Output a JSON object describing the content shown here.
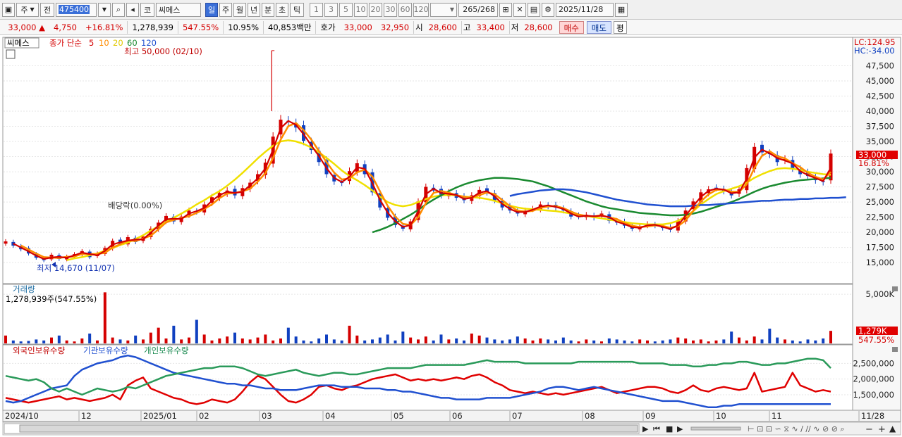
{
  "toolbar": {
    "period_label": "주",
    "prev_label": "전",
    "code": "475400",
    "market_label": "코",
    "name": "씨메스",
    "periods": [
      "일",
      "주",
      "월",
      "년",
      "분",
      "초",
      "틱"
    ],
    "active_period": "일",
    "intervals": [
      "1",
      "3",
      "5",
      "10",
      "20",
      "30",
      "60",
      "120"
    ],
    "count": "265",
    "count_total": "/268",
    "date": "2025/11/28"
  },
  "quote": {
    "price": "33,000",
    "change": "4,750",
    "change_pct": "+16.81%",
    "volume": "1,278,939",
    "volume_pct": "547.55%",
    "turnover": "10.95%",
    "amount": "40,853백만",
    "bid_label": "호가",
    "ask": "33,000",
    "bid": "32,950",
    "open_label": "시",
    "open": "28,600",
    "high_label": "고",
    "high": "33,400",
    "low_label": "저",
    "low": "28,600",
    "buy_label": "매수",
    "sell_label": "매도",
    "eval_label": "평"
  },
  "colors": {
    "up": "#d40000",
    "down": "#1040c0",
    "ma5": "#d40000",
    "ma10": "#ff8c00",
    "ma20": "#f0e000",
    "ma60": "#1a8a30",
    "ma120": "#2050d0"
  },
  "chart_data": [
    {
      "type": "candlestick",
      "title": "씨메스",
      "legend": [
        "종가 단순",
        "5",
        "10",
        "20",
        "60",
        "120"
      ],
      "x": [
        "2024/10",
        "12",
        "2025/01",
        "02",
        "03",
        "04",
        "05",
        "06",
        "07",
        "08",
        "09",
        "10",
        "11",
        "11/28"
      ],
      "y_ticks": [
        15000,
        17500,
        20000,
        22500,
        25000,
        27500,
        30000,
        32500,
        35000,
        37500,
        40000,
        42500,
        45000,
        47500
      ],
      "y_tick_labels": [
        "15,000",
        "17,500",
        "20,000",
        "22,500",
        "25,000",
        "27,500",
        "30,000",
        "32,500",
        "35,000",
        "37,500",
        "40,000",
        "42,500",
        "45,000",
        "47,500"
      ],
      "ylim": [
        12000,
        51500
      ],
      "annotations": {
        "max": "최고 50,000 (02/10)",
        "min": "최저 14,670 (11/07)",
        "dividend": "배당락(0.00%)",
        "lc": "LC:124.95",
        "hc": "HC:-34.00",
        "last_price": "33,000",
        "last_pct": "16.81%"
      },
      "series": [
        {
          "name": "close",
          "values": [
            18500,
            17800,
            17200,
            16500,
            15800,
            15400,
            16300,
            15600,
            16000,
            16400,
            16900,
            15900,
            16500,
            17400,
            18600,
            18100,
            19200,
            18400,
            19300,
            20600,
            21600,
            22700,
            21800,
            22600,
            23600,
            23400,
            24600,
            25800,
            26500,
            26900,
            26100,
            27300,
            28200,
            29600,
            31500,
            35800,
            38600,
            38200,
            37300,
            35100,
            33600,
            31600,
            29600,
            28400,
            28200,
            30100,
            31400,
            29600,
            26600,
            24100,
            22400,
            21200,
            20600,
            21800,
            25100,
            27500,
            26900,
            26100,
            26600,
            25700,
            25300,
            26100,
            27000,
            26600,
            25300,
            24100,
            23600,
            23100,
            23600,
            23900,
            24600,
            24300,
            24100,
            23600,
            22600,
            22600,
            22900,
            22400,
            23100,
            21900,
            21600,
            21100,
            20600,
            20900,
            21400,
            21100,
            20700,
            20400,
            21900,
            23600,
            25100,
            26600,
            27100,
            27300,
            26800,
            26100,
            27100,
            30600,
            34100,
            33200,
            32900,
            31600,
            32100,
            30600,
            29600,
            29300,
            28600,
            28300,
            33000
          ]
        },
        {
          "name": "ma20",
          "values": [
            null,
            null,
            null,
            null,
            null,
            null,
            null,
            null,
            15400,
            15700,
            15900,
            16200,
            16500,
            17000,
            17400,
            17900,
            18300,
            18900,
            19500,
            20300,
            21000,
            21700,
            22400,
            23100,
            23800,
            24600,
            25300,
            26100,
            26800,
            27700,
            28700,
            29800,
            31000,
            32200,
            33300,
            34300,
            35000,
            35200,
            35000,
            34600,
            34000,
            33200,
            32300,
            31300,
            30200,
            29300,
            28600,
            27800,
            26900,
            25900,
            25000,
            24500,
            24300,
            24500,
            25000,
            25500,
            25900,
            26100,
            26200,
            26100,
            25900,
            25800,
            25700,
            25500,
            25200,
            24800,
            24400,
            24100,
            23900,
            23800,
            23700,
            23600,
            23500,
            23300,
            23100,
            22900,
            22700,
            22500,
            22300,
            22100,
            21900,
            21700,
            21500,
            21400,
            21300,
            21300,
            21300,
            21500,
            21900,
            22600,
            23500,
            24600,
            25500,
            26300,
            26800,
            27200,
            27600,
            28200,
            29000,
            29600,
            30100,
            30500,
            30600,
            30500,
            30300,
            30000,
            29800,
            29600,
            29500
          ]
        },
        {
          "name": "ma60",
          "values": [
            null,
            null,
            null,
            null,
            null,
            null,
            null,
            null,
            null,
            null,
            null,
            null,
            null,
            null,
            null,
            null,
            null,
            null,
            null,
            null,
            null,
            null,
            null,
            null,
            null,
            null,
            null,
            null,
            null,
            null,
            null,
            null,
            null,
            null,
            null,
            null,
            null,
            null,
            null,
            null,
            null,
            null,
            null,
            null,
            null,
            null,
            null,
            null,
            20000,
            20400,
            20900,
            21500,
            22200,
            22900,
            23700,
            24600,
            25400,
            26100,
            26800,
            27400,
            27900,
            28300,
            28600,
            28800,
            29000,
            29000,
            28900,
            28800,
            28600,
            28400,
            28000,
            27600,
            27100,
            26600,
            26100,
            25600,
            25100,
            24700,
            24300,
            24000,
            23800,
            23600,
            23400,
            23200,
            23100,
            23000,
            22900,
            22800,
            22800,
            22900,
            23100,
            23400,
            23800,
            24200,
            24600,
            25000,
            25500,
            26100,
            26700,
            27200,
            27600,
            27900,
            28200,
            28400,
            28600,
            28700,
            28800,
            28900,
            29000
          ]
        },
        {
          "name": "ma120",
          "values": [
            null,
            null,
            null,
            null,
            null,
            null,
            null,
            null,
            null,
            null,
            null,
            null,
            null,
            null,
            null,
            null,
            null,
            null,
            null,
            null,
            null,
            null,
            null,
            null,
            null,
            null,
            null,
            null,
            null,
            null,
            null,
            null,
            null,
            null,
            null,
            null,
            null,
            null,
            null,
            null,
            null,
            null,
            null,
            null,
            null,
            null,
            null,
            null,
            null,
            null,
            null,
            null,
            null,
            null,
            null,
            null,
            null,
            null,
            null,
            null,
            null,
            null,
            null,
            null,
            null,
            null,
            26000,
            26300,
            26500,
            26700,
            26900,
            27000,
            27100,
            27100,
            27000,
            26800,
            26600,
            26300,
            26000,
            25700,
            25400,
            25200,
            25000,
            24800,
            24600,
            24500,
            24400,
            24300,
            24300,
            24300,
            24400,
            24500,
            24500,
            24600,
            24700,
            24800,
            24900,
            25000,
            25100,
            25200,
            25200,
            25300,
            25400,
            25400,
            25500,
            25500,
            25600,
            25600,
            25700,
            25700,
            25800
          ]
        }
      ]
    },
    {
      "type": "bar",
      "title": "거래량",
      "info": "1,278,939주(547.55%)",
      "y_tick_labels": [
        "5,000K"
      ],
      "last_value_label": "1,279K",
      "last_pct": "547.55%",
      "series": [
        {
          "name": "volume",
          "values": [
            800,
            300,
            200,
            250,
            400,
            300,
            600,
            800,
            300,
            200,
            500,
            1000,
            300,
            5200,
            600,
            400,
            300,
            800,
            400,
            1100,
            1600,
            500,
            1800,
            400,
            600,
            2400,
            900,
            300,
            500,
            700,
            1100,
            500,
            400,
            600,
            900,
            300,
            500,
            1600,
            700,
            300,
            200,
            500,
            900,
            400,
            300,
            1800,
            800,
            300,
            400,
            600,
            900,
            300,
            1200,
            600,
            400,
            700,
            300,
            900,
            400,
            500,
            300,
            1000,
            800,
            600,
            400,
            300,
            400,
            700,
            500,
            300,
            500,
            400,
            300,
            600,
            300,
            200,
            400,
            300,
            200,
            500,
            400,
            300,
            200,
            400,
            300,
            200,
            300,
            400,
            600,
            500,
            300,
            400,
            200,
            300,
            400,
            1200,
            600,
            300,
            700,
            400,
            1500,
            600,
            400,
            300,
            200,
            400,
            300,
            500,
            1279
          ]
        }
      ]
    },
    {
      "type": "line",
      "title": "외국인보유수량",
      "legend": [
        "외국인보유수량",
        "기관보유수량",
        "개인보유수량"
      ],
      "y_tick_labels": [
        "2,500,000",
        "2,000,000",
        "1,500,000"
      ],
      "series": [
        {
          "name": "외국인보유수량",
          "values": [
            1400,
            1350,
            1300,
            1250,
            1300,
            1350,
            1400,
            1450,
            1350,
            1400,
            1350,
            1300,
            1350,
            1400,
            1500,
            1350,
            1800,
            1950,
            2050,
            1700,
            1600,
            1500,
            1400,
            1350,
            1250,
            1200,
            1250,
            1350,
            1300,
            1250,
            1350,
            1600,
            1900,
            2100,
            2000,
            1750,
            1500,
            1300,
            1250,
            1350,
            1500,
            1750,
            1800,
            1700,
            1650,
            1750,
            1800,
            1900,
            2000,
            2050,
            2100,
            2150,
            2050,
            1950,
            2000,
            1950,
            2000,
            1950,
            2000,
            2050,
            2000,
            2100,
            2150,
            2050,
            1900,
            1800,
            1650,
            1600,
            1550,
            1600,
            1550,
            1500,
            1550,
            1500,
            1550,
            1600,
            1650,
            1700,
            1750,
            1650,
            1550,
            1600,
            1650,
            1700,
            1750,
            1750,
            1700,
            1600,
            1550,
            1650,
            1800,
            1650,
            1600,
            1700,
            1750,
            1700,
            1650,
            1700,
            2200,
            1600,
            1650,
            1700,
            1750,
            2200,
            1800,
            1700,
            1600,
            1650,
            1600
          ]
        },
        {
          "name": "기관보유수량",
          "values": [
            1300,
            1250,
            1300,
            1400,
            1500,
            1600,
            1700,
            1750,
            1800,
            2100,
            2300,
            2400,
            2500,
            2550,
            2600,
            2700,
            2750,
            2700,
            2600,
            2500,
            2400,
            2300,
            2200,
            2150,
            2100,
            2050,
            2000,
            1950,
            1900,
            1850,
            1850,
            1800,
            1800,
            1750,
            1700,
            1700,
            1650,
            1650,
            1650,
            1700,
            1750,
            1800,
            1800,
            1800,
            1750,
            1750,
            1750,
            1700,
            1700,
            1700,
            1650,
            1650,
            1600,
            1600,
            1550,
            1500,
            1450,
            1400,
            1400,
            1350,
            1350,
            1350,
            1350,
            1400,
            1400,
            1400,
            1400,
            1450,
            1500,
            1550,
            1600,
            1700,
            1750,
            1750,
            1700,
            1650,
            1700,
            1750,
            1700,
            1650,
            1600,
            1550,
            1500,
            1450,
            1400,
            1350,
            1300,
            1300,
            1300,
            1250,
            1200,
            1150,
            1100,
            1100,
            1150,
            1150,
            1200,
            1200,
            1200,
            1200,
            1200,
            1200,
            1200,
            1200,
            1200,
            1200,
            1200,
            1200,
            1200
          ]
        },
        {
          "name": "개인보유수량",
          "values": [
            2100,
            2050,
            2000,
            1950,
            2000,
            1900,
            1700,
            1600,
            1700,
            1600,
            1500,
            1600,
            1700,
            1650,
            1600,
            1650,
            1750,
            1700,
            1800,
            1900,
            2000,
            2100,
            2150,
            2200,
            2250,
            2300,
            2350,
            2350,
            2400,
            2400,
            2400,
            2350,
            2250,
            2150,
            2100,
            2150,
            2200,
            2250,
            2300,
            2200,
            2150,
            2100,
            2150,
            2200,
            2200,
            2150,
            2150,
            2200,
            2250,
            2300,
            2350,
            2350,
            2350,
            2350,
            2400,
            2450,
            2450,
            2450,
            2450,
            2450,
            2450,
            2500,
            2550,
            2600,
            2550,
            2550,
            2550,
            2550,
            2500,
            2500,
            2500,
            2500,
            2500,
            2500,
            2500,
            2550,
            2550,
            2550,
            2550,
            2550,
            2550,
            2550,
            2550,
            2500,
            2500,
            2500,
            2500,
            2450,
            2450,
            2450,
            2400,
            2400,
            2450,
            2450,
            2500,
            2500,
            2550,
            2550,
            2500,
            2450,
            2450,
            2500,
            2500,
            2550,
            2600,
            2650,
            2650,
            2600,
            2350
          ]
        }
      ]
    }
  ],
  "footer": {
    "ui_glyphs": [
      "▶",
      "⏮",
      "■",
      "▶"
    ]
  }
}
